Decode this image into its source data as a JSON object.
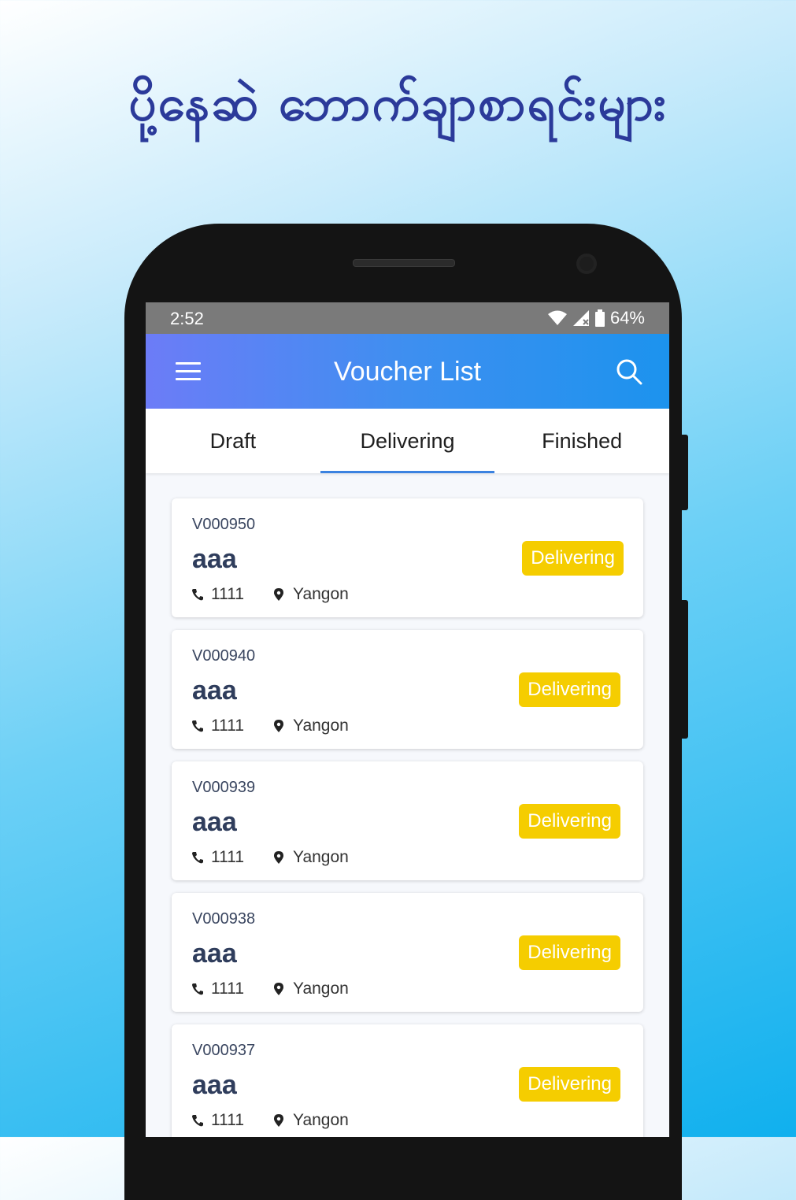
{
  "promo": {
    "title": "ပို့နေဆဲ ဘောက်ချာစာရင်းများ"
  },
  "status_bar": {
    "time": "2:52",
    "battery": "64%"
  },
  "app_bar": {
    "title": "Voucher List"
  },
  "tabs": [
    {
      "label": "Draft",
      "active": false
    },
    {
      "label": "Delivering",
      "active": true
    },
    {
      "label": "Finished",
      "active": false
    }
  ],
  "vouchers": [
    {
      "id": "V000950",
      "name": "aaa",
      "phone": "1111",
      "location": "Yangon",
      "status": "Delivering"
    },
    {
      "id": "V000940",
      "name": "aaa",
      "phone": "1111",
      "location": "Yangon",
      "status": "Delivering"
    },
    {
      "id": "V000939",
      "name": "aaa",
      "phone": "1111",
      "location": "Yangon",
      "status": "Delivering"
    },
    {
      "id": "V000938",
      "name": "aaa",
      "phone": "1111",
      "location": "Yangon",
      "status": "Delivering"
    },
    {
      "id": "V000937",
      "name": "aaa",
      "phone": "1111",
      "location": "Yangon",
      "status": "Delivering"
    }
  ],
  "colors": {
    "accent": "#3b82e0",
    "badge": "#f5cd00",
    "title": "#2b3a9a"
  }
}
